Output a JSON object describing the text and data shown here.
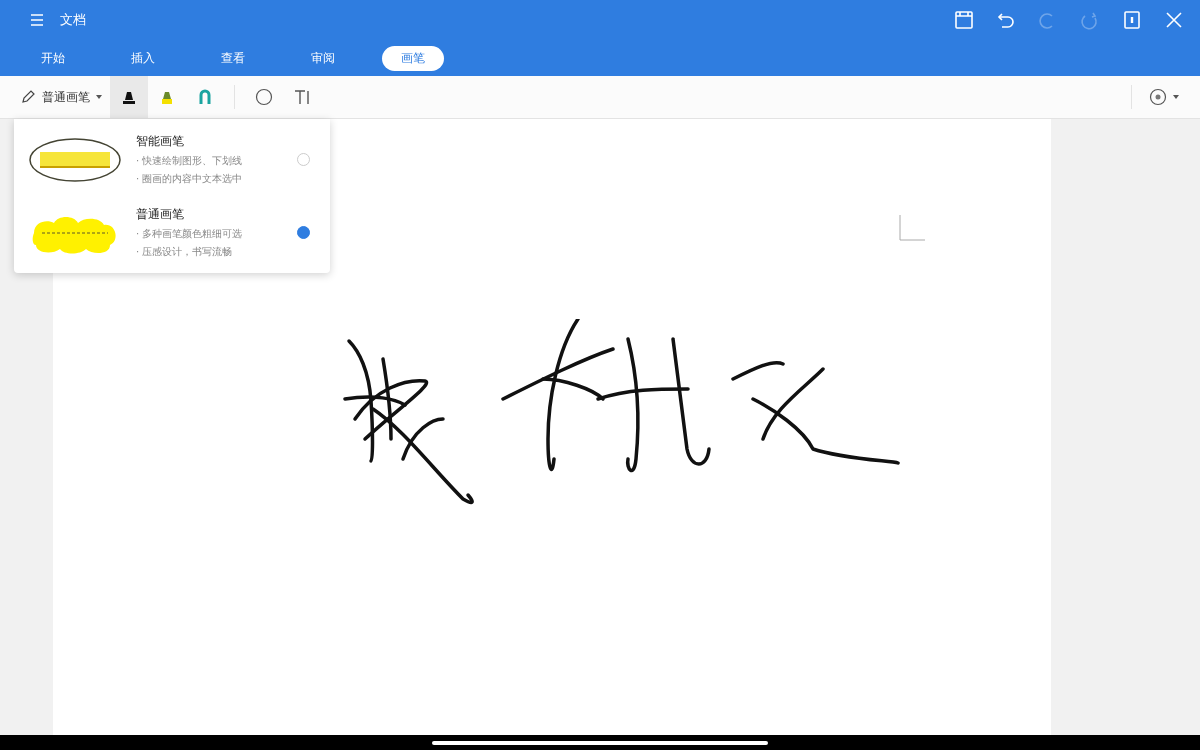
{
  "window": {
    "title": "文档"
  },
  "title_actions": [
    {
      "kind": "save",
      "disabled": false
    },
    {
      "kind": "undo",
      "disabled": false
    },
    {
      "kind": "redo",
      "disabled": true
    },
    {
      "kind": "repeat",
      "disabled": true
    },
    {
      "kind": "page",
      "disabled": false
    },
    {
      "kind": "close",
      "disabled": false
    }
  ],
  "tabs": [
    {
      "label": "开始",
      "selected": false
    },
    {
      "label": "插入",
      "selected": false
    },
    {
      "label": "查看",
      "selected": false
    },
    {
      "label": "审阅",
      "selected": false
    },
    {
      "label": "画笔",
      "selected": true
    }
  ],
  "toolbar": {
    "pen_mode": "普通画笔",
    "tools": [
      {
        "kind": "marker",
        "selected": true
      },
      {
        "kind": "highlighter",
        "selected": false
      },
      {
        "kind": "eraser",
        "selected": false
      },
      {
        "kind": "shape",
        "selected": false
      },
      {
        "kind": "text",
        "selected": false
      }
    ]
  },
  "pen_menu": [
    {
      "kind": "smart",
      "name": "智能画笔",
      "lines": [
        "· 快速绘制图形、下划线",
        "· 圈画的内容中文本选中"
      ],
      "selected": false
    },
    {
      "kind": "normal",
      "name": "普通画笔",
      "lines": [
        "· 多种画笔颜色粗细可选",
        "· 压感设计，书写流畅"
      ],
      "selected": true
    }
  ]
}
